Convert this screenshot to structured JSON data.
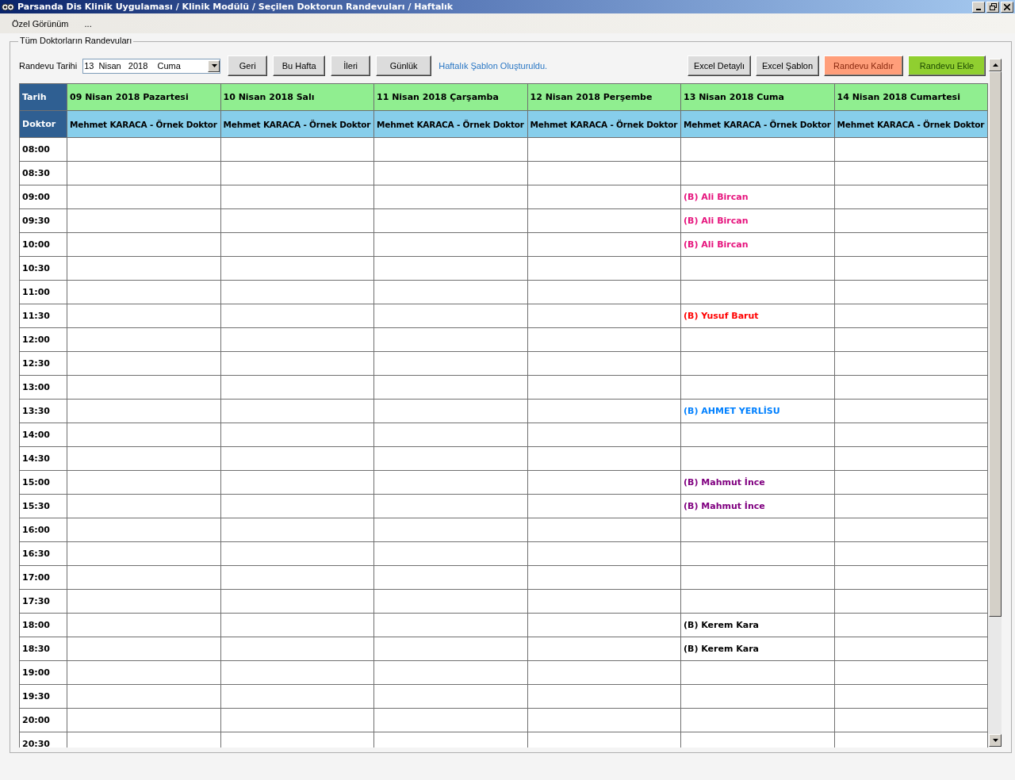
{
  "window": {
    "title": "Parsanda Dis Klinik Uygulaması / Klinik Modülü / Seçilen Doktorun Randevuları / Haftalık"
  },
  "menu": [
    "Özel Görünüm",
    "..."
  ],
  "group": {
    "title": "Tüm Doktorların Randevuları"
  },
  "toolbar": {
    "date_label": "Randevu Tarihi",
    "date_value": "13  Nisan   2018    Cuma",
    "nav_buttons": [
      "Geri",
      "Bu Hafta",
      "İleri",
      "Günlük"
    ],
    "status": "Haftalık Şablon Oluşturuldu.",
    "action_buttons": [
      {
        "label": "Excel Detaylı",
        "kind": "plain"
      },
      {
        "label": "Excel Şablon",
        "kind": "plain"
      },
      {
        "label": "Randevu Kaldır",
        "kind": "remove"
      },
      {
        "label": "Randevu Ekle",
        "kind": "add"
      }
    ]
  },
  "table": {
    "date_header": "Tarih",
    "doctor_header": "Doktor",
    "days": [
      {
        "date": "09 Nisan 2018 Pazartesi",
        "doctor": "Mehmet KARACA - Örnek Doktor"
      },
      {
        "date": "10 Nisan 2018 Salı",
        "doctor": "Mehmet KARACA - Örnek Doktor"
      },
      {
        "date": "11 Nisan 2018 Çarşamba",
        "doctor": "Mehmet KARACA - Örnek Doktor"
      },
      {
        "date": "12 Nisan 2018 Perşembe",
        "doctor": "Mehmet KARACA - Örnek Doktor"
      },
      {
        "date": "13 Nisan 2018 Cuma",
        "doctor": "Mehmet KARACA - Örnek Doktor"
      },
      {
        "date": "14 Nisan 2018 Cumartesi",
        "doctor": "Mehmet KARACA - Örnek Doktor"
      }
    ],
    "rows": [
      {
        "time": "08:00",
        "cells": [
          {},
          {},
          {},
          {},
          {},
          {}
        ]
      },
      {
        "time": "08:30",
        "cells": [
          {},
          {},
          {},
          {},
          {},
          {}
        ]
      },
      {
        "time": "09:00",
        "cells": [
          {},
          {},
          {},
          {},
          {
            "text": "(B) Ali Bircan",
            "color": "#e6127c"
          },
          {}
        ]
      },
      {
        "time": "09:30",
        "cells": [
          {},
          {},
          {},
          {},
          {
            "text": "(B) Ali Bircan",
            "color": "#e6127c"
          },
          {}
        ]
      },
      {
        "time": "10:00",
        "cells": [
          {},
          {},
          {},
          {},
          {
            "text": "(B) Ali Bircan",
            "color": "#e6127c"
          },
          {}
        ]
      },
      {
        "time": "10:30",
        "cells": [
          {},
          {},
          {},
          {},
          {},
          {}
        ]
      },
      {
        "time": "11:00",
        "cells": [
          {},
          {},
          {},
          {},
          {},
          {}
        ]
      },
      {
        "time": "11:30",
        "cells": [
          {},
          {},
          {},
          {},
          {
            "text": "(B) Yusuf Barut",
            "color": "#ff0000"
          },
          {}
        ]
      },
      {
        "time": "12:00",
        "cells": [
          {},
          {},
          {},
          {},
          {},
          {}
        ]
      },
      {
        "time": "12:30",
        "cells": [
          {},
          {},
          {},
          {},
          {},
          {}
        ]
      },
      {
        "time": "13:00",
        "cells": [
          {},
          {},
          {},
          {},
          {},
          {}
        ]
      },
      {
        "time": "13:30",
        "cells": [
          {},
          {},
          {},
          {},
          {
            "text": "(B) AHMET YERLİSU",
            "color": "#0080ff"
          },
          {}
        ]
      },
      {
        "time": "14:00",
        "cells": [
          {},
          {},
          {},
          {},
          {},
          {}
        ]
      },
      {
        "time": "14:30",
        "cells": [
          {},
          {},
          {},
          {},
          {},
          {}
        ]
      },
      {
        "time": "15:00",
        "cells": [
          {},
          {},
          {},
          {},
          {
            "text": "(B) Mahmut İnce",
            "color": "#800080"
          },
          {}
        ]
      },
      {
        "time": "15:30",
        "cells": [
          {},
          {},
          {},
          {},
          {
            "text": "(B) Mahmut İnce",
            "color": "#800080"
          },
          {}
        ]
      },
      {
        "time": "16:00",
        "cells": [
          {},
          {},
          {},
          {},
          {},
          {}
        ]
      },
      {
        "time": "16:30",
        "cells": [
          {},
          {},
          {},
          {},
          {},
          {}
        ]
      },
      {
        "time": "17:00",
        "cells": [
          {},
          {},
          {},
          {},
          {},
          {}
        ]
      },
      {
        "time": "17:30",
        "cells": [
          {},
          {},
          {},
          {},
          {},
          {}
        ]
      },
      {
        "time": "18:00",
        "cells": [
          {},
          {},
          {},
          {},
          {
            "text": "(B) Kerem Kara",
            "color": "#000000"
          },
          {}
        ]
      },
      {
        "time": "18:30",
        "cells": [
          {},
          {},
          {},
          {},
          {
            "text": "(B) Kerem Kara",
            "color": "#000000"
          },
          {}
        ]
      },
      {
        "time": "19:00",
        "cells": [
          {},
          {},
          {},
          {},
          {},
          {}
        ]
      },
      {
        "time": "19:30",
        "cells": [
          {},
          {},
          {},
          {},
          {},
          {}
        ]
      },
      {
        "time": "20:00",
        "cells": [
          {},
          {},
          {},
          {},
          {},
          {}
        ]
      },
      {
        "time": "20:30",
        "cells": [
          {},
          {},
          {},
          {},
          {},
          {}
        ]
      }
    ]
  }
}
